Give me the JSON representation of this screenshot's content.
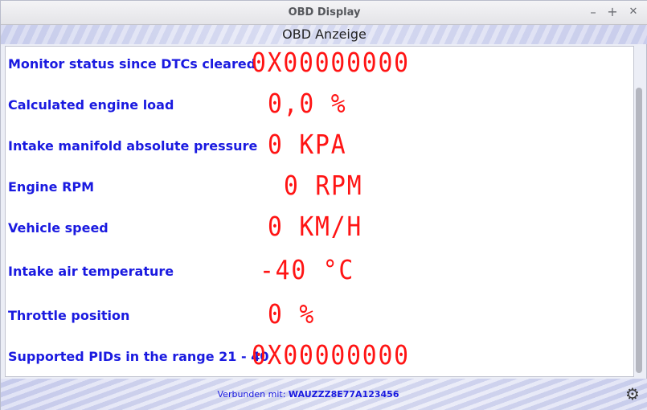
{
  "window": {
    "title": "OBD Display",
    "controls": {
      "minimize": "–",
      "maximize": "+",
      "close": "✕"
    }
  },
  "app": {
    "title": "OBD Anzeige"
  },
  "readings": [
    {
      "label": "Monitor status since DTCs cleared",
      "value": "0X00000000"
    },
    {
      "label": "Calculated engine load",
      "value": "0,0 %"
    },
    {
      "label": "Intake manifold absolute pressure",
      "value": "0 KPA"
    },
    {
      "label": "Engine RPM",
      "value": "0 RPM"
    },
    {
      "label": "Vehicle speed",
      "value": "0 KM/H"
    },
    {
      "label": "Intake air temperature",
      "value": "-40 °C"
    },
    {
      "label": "Throttle position",
      "value": "0 %"
    },
    {
      "label": "Supported PIDs in the range 21 - 40",
      "value": "0X00000000"
    }
  ],
  "status": {
    "prefix": "Verbunden mit:",
    "vin": "WAUZZZ8E77A123456"
  },
  "icons": {
    "settings": "gear-icon"
  },
  "colors": {
    "label": "#1a1ae0",
    "value": "#ff1414",
    "status": "#1a1ae0"
  }
}
